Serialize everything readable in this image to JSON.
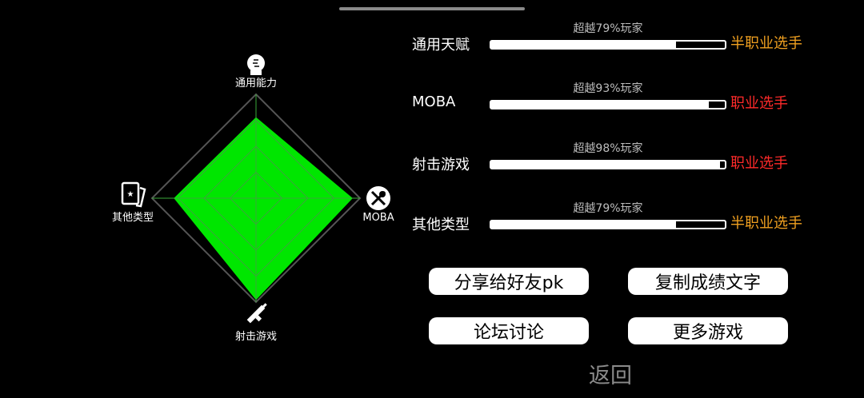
{
  "radar": {
    "axes": [
      {
        "label": "通用能力",
        "icon": "head-icon",
        "value": 0.78
      },
      {
        "label": "MOBA",
        "icon": "crossed-sword-icon",
        "value": 0.93
      },
      {
        "label": "射击游戏",
        "icon": "rifle-icon",
        "value": 0.98
      },
      {
        "label": "其他类型",
        "icon": "card-icon",
        "value": 0.79
      }
    ],
    "fill_color": "#00e600",
    "grid_color": "#555555"
  },
  "stats": [
    {
      "name": "通用天赋",
      "percent_text": "超越79%玩家",
      "percent": 79,
      "rank": "半职业选手",
      "rank_color": "#f0a020"
    },
    {
      "name": "MOBA",
      "percent_text": "超越93%玩家",
      "percent": 93,
      "rank": "职业选手",
      "rank_color": "#ff2a2a"
    },
    {
      "name": "射击游戏",
      "percent_text": "超越98%玩家",
      "percent": 98,
      "rank": "职业选手",
      "rank_color": "#ff2a2a"
    },
    {
      "name": "其他类型",
      "percent_text": "超越79%玩家",
      "percent": 79,
      "rank": "半职业选手",
      "rank_color": "#f0a020"
    }
  ],
  "buttons": {
    "share": "分享给好友pk",
    "copy": "复制成绩文字",
    "forum": "论坛讨论",
    "more": "更多游戏"
  },
  "back_label": "返回"
}
